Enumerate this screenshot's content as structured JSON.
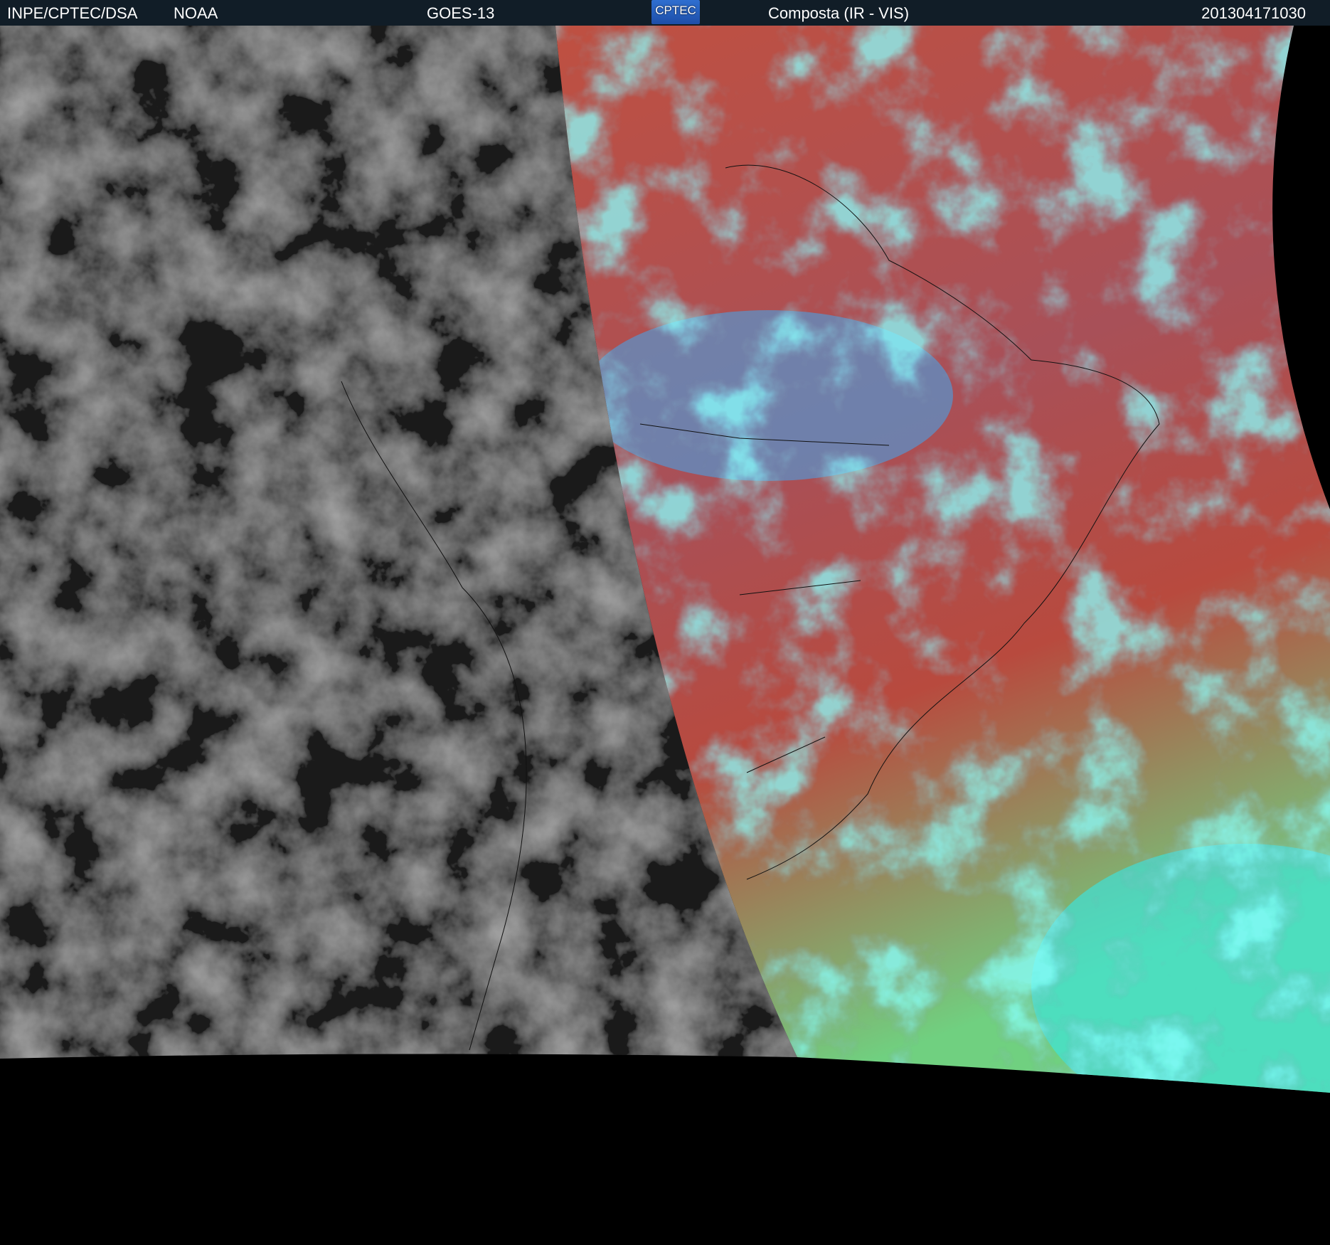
{
  "header": {
    "agency": "INPE/CPTEC/DSA",
    "partner": "NOAA",
    "satellite": "GOES-13",
    "logo_text": "CPTEC",
    "product": "Composta (IR - VIS)",
    "timestamp": "201304171030"
  },
  "colors": {
    "header_bg": "#111d27",
    "ir_gray": "#3a3a3a",
    "vis_red": "#b84a3e",
    "cyan": "#35e8e8",
    "green": "#8ee070"
  }
}
